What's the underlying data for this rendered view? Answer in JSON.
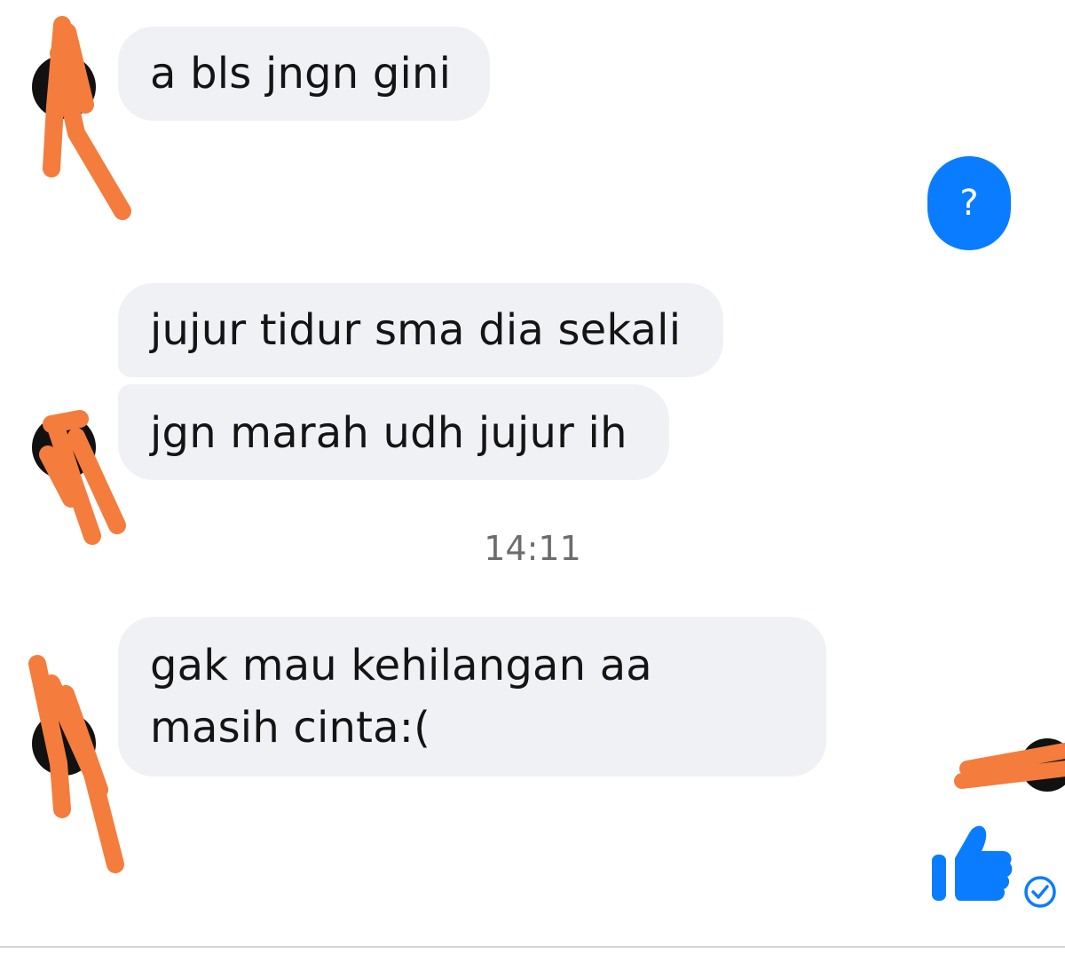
{
  "conversation": {
    "messages": [
      {
        "direction": "incoming",
        "lines": [
          "a bls jngn gini"
        ]
      },
      {
        "direction": "outgoing",
        "lines": [
          "?"
        ]
      },
      {
        "direction": "incoming",
        "lines": [
          "jujur tidur sma dia sekali"
        ]
      },
      {
        "direction": "incoming",
        "lines": [
          "jgn marah udh jujur ih"
        ]
      },
      {
        "direction": "incoming",
        "lines": [
          "gak mau kehilangan aa",
          "masih cinta:("
        ]
      }
    ],
    "timestamp": "14:11"
  },
  "composer": {
    "like_icon": "thumbs-up-icon",
    "seen_icon": "check-circle-icon"
  },
  "colors": {
    "incoming_bubble": "#f0f1f5",
    "outgoing_bubble": "#0a7cff",
    "like": "#0a7cff",
    "redaction": "#f47c3c"
  }
}
